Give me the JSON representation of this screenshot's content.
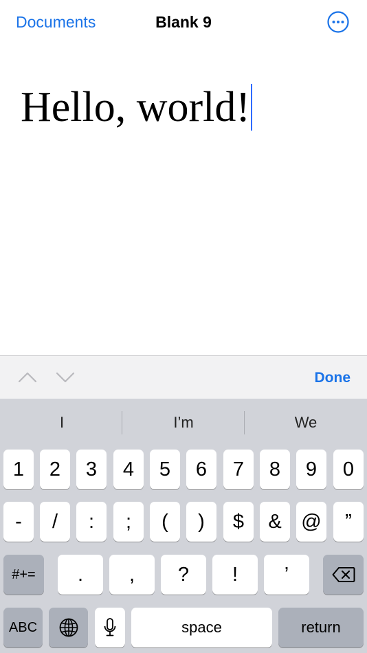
{
  "nav": {
    "back_label": "Documents",
    "title": "Blank 9",
    "more_icon": "ellipsis-circle-icon"
  },
  "document": {
    "text": "Hello, world!"
  },
  "accessory": {
    "prev_icon": "chevron-up-icon",
    "next_icon": "chevron-down-icon",
    "done_label": "Done"
  },
  "keyboard": {
    "suggestions": [
      "I",
      "I’m",
      "We"
    ],
    "row1": [
      "1",
      "2",
      "3",
      "4",
      "5",
      "6",
      "7",
      "8",
      "9",
      "0"
    ],
    "row2": [
      "-",
      "/",
      ":",
      ";",
      "(",
      ")",
      "$",
      "&",
      "@",
      "”"
    ],
    "row3": {
      "mode_key": "#+=",
      "keys": [
        ".",
        ",",
        "?",
        "!",
        "’"
      ],
      "delete_icon": "backspace-icon"
    },
    "row4": {
      "abc_key": "ABC",
      "globe_icon": "globe-icon",
      "mic_icon": "microphone-icon",
      "space_label": "space",
      "return_label": "return"
    }
  },
  "colors": {
    "accent": "#1a73e8",
    "caret": "#2f6bff",
    "keyboard_bg": "#d1d3d9",
    "key_bg": "#ffffff",
    "dark_key_bg": "#abb0ba"
  }
}
